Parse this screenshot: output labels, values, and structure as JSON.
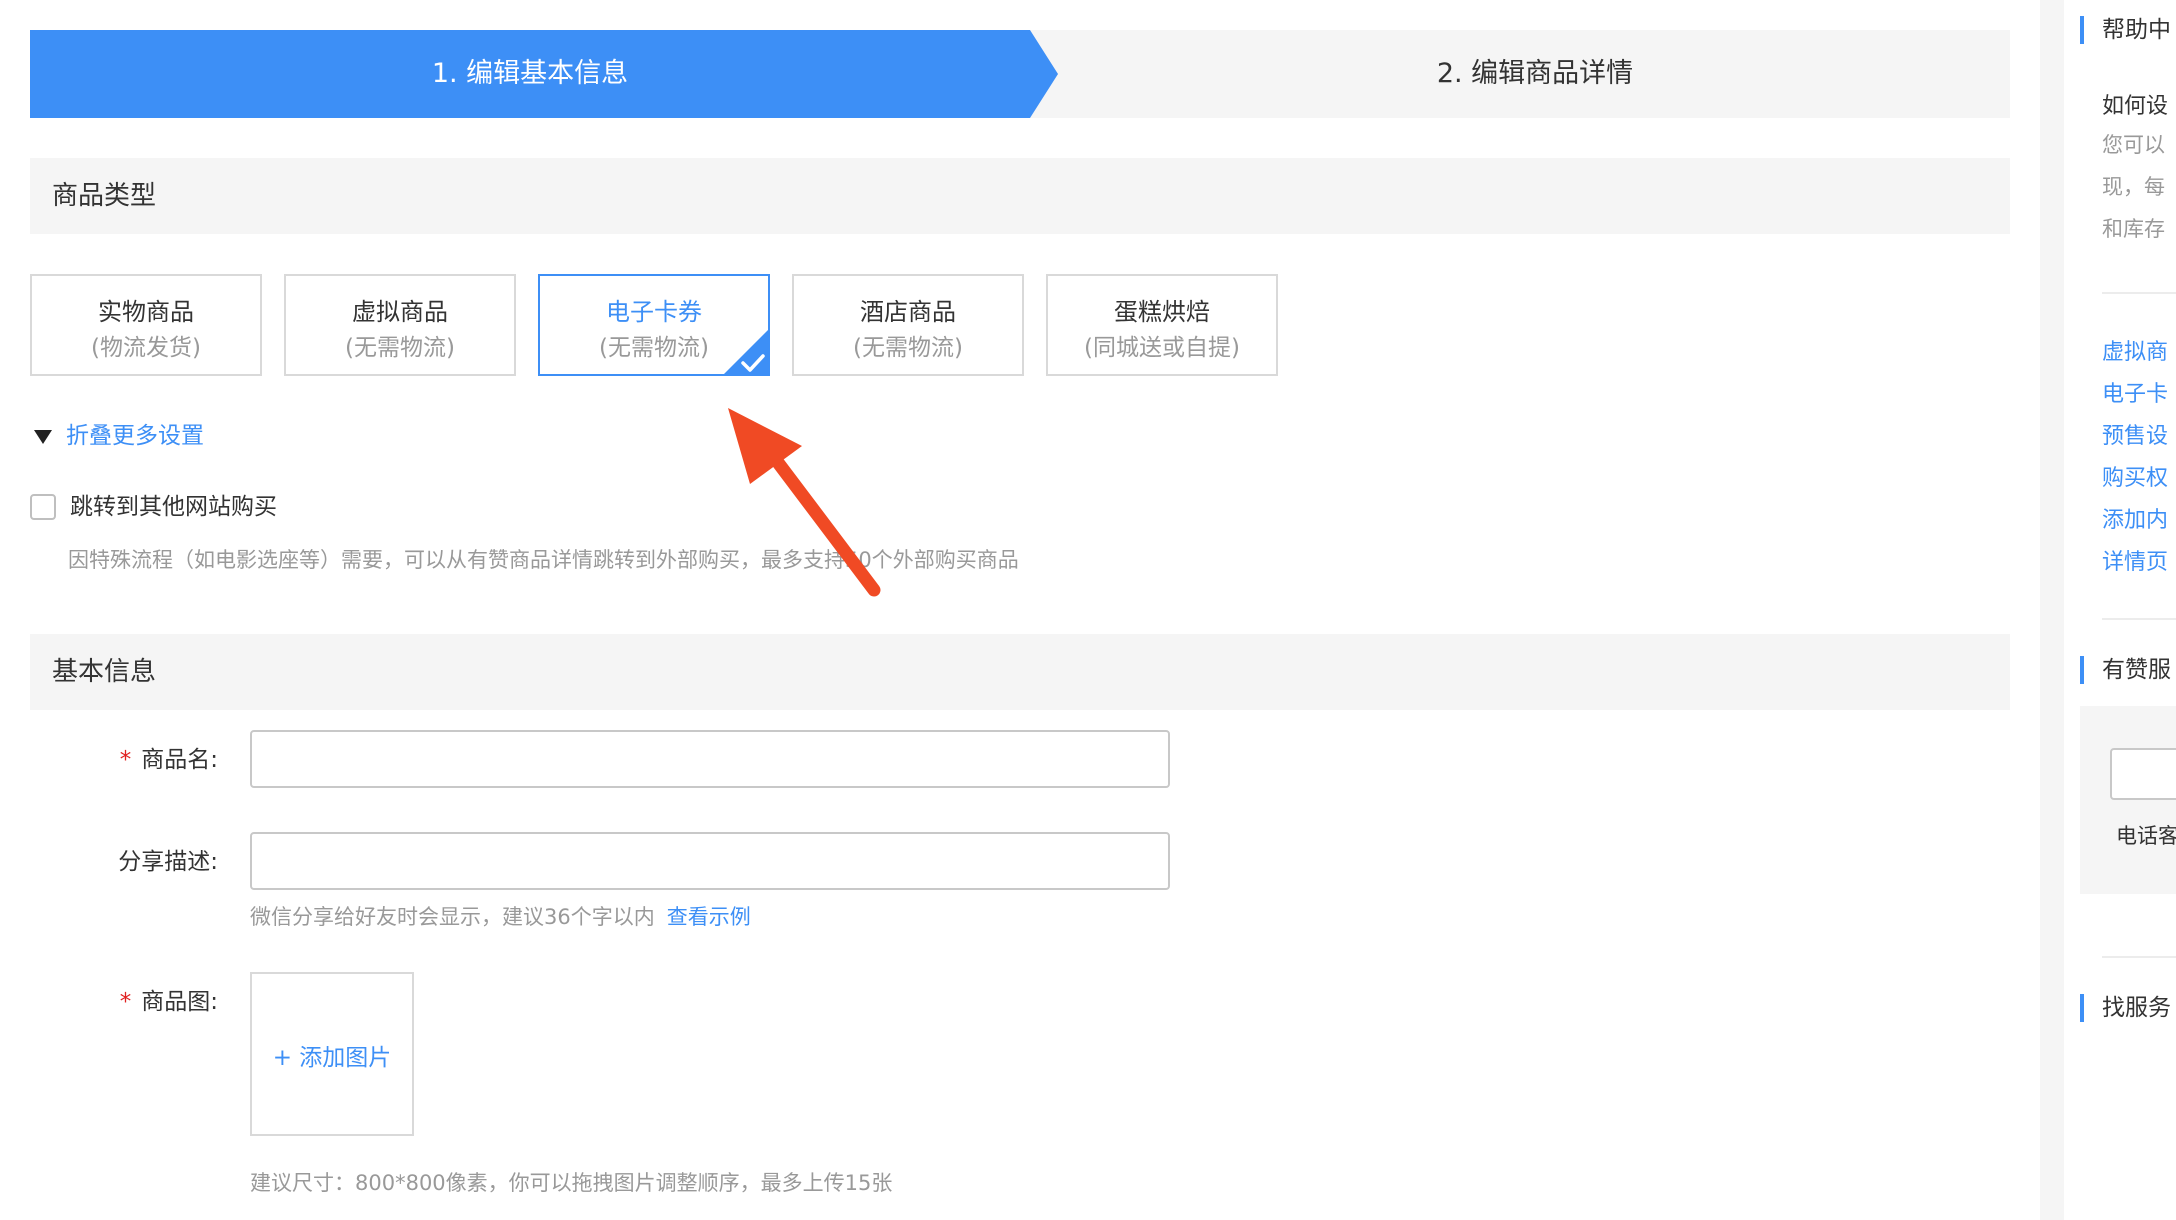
{
  "steps": [
    {
      "label": "1. 编辑基本信息",
      "active": true
    },
    {
      "label": "2. 编辑商品详情",
      "active": false
    }
  ],
  "product_type": {
    "title": "商品类型",
    "cards": [
      {
        "title": "实物商品",
        "sub": "(物流发货)",
        "selected": false
      },
      {
        "title": "虚拟商品",
        "sub": "(无需物流)",
        "selected": false
      },
      {
        "title": "电子卡券",
        "sub": "(无需物流)",
        "selected": true
      },
      {
        "title": "酒店商品",
        "sub": "(无需物流)",
        "selected": false
      },
      {
        "title": "蛋糕烘焙",
        "sub": "(同城送或自提)",
        "selected": false
      }
    ],
    "collapse_label": "折叠更多设置",
    "redirect_checkbox": {
      "label": "跳转到其他网站购买",
      "checked": false,
      "hint": "因特殊流程（如电影选座等）需要，可以从有赞商品详情跳转到外部购买，最多支持50个外部购买商品"
    }
  },
  "basic_info": {
    "title": "基本信息",
    "name": {
      "label": "商品名:",
      "required": true,
      "value": ""
    },
    "desc": {
      "label": "分享描述:",
      "required": false,
      "value": "",
      "hint": "微信分享给好友时会显示，建议36个字以内",
      "example_link": "查看示例"
    },
    "image": {
      "label": "商品图:",
      "required": true,
      "add_label": "+ 添加图片",
      "hint": "建议尺寸：800*800像素，你可以拖拽图片调整顺序，最多上传15张"
    }
  },
  "sidebar": {
    "help_title": "帮助中",
    "question": "如何设",
    "answer_lines": [
      "您可以",
      "现，每",
      "和库存"
    ],
    "links": [
      "虚拟商",
      "电子卡",
      "预售设",
      "购买权",
      "添加内",
      "详情页"
    ],
    "service_title": "有赞服",
    "service_phone": "电话客",
    "find_service": "找服务"
  },
  "colors": {
    "accent": "#3d8ff6",
    "required": "#e02020",
    "annotation_arrow": "#f04a24"
  }
}
